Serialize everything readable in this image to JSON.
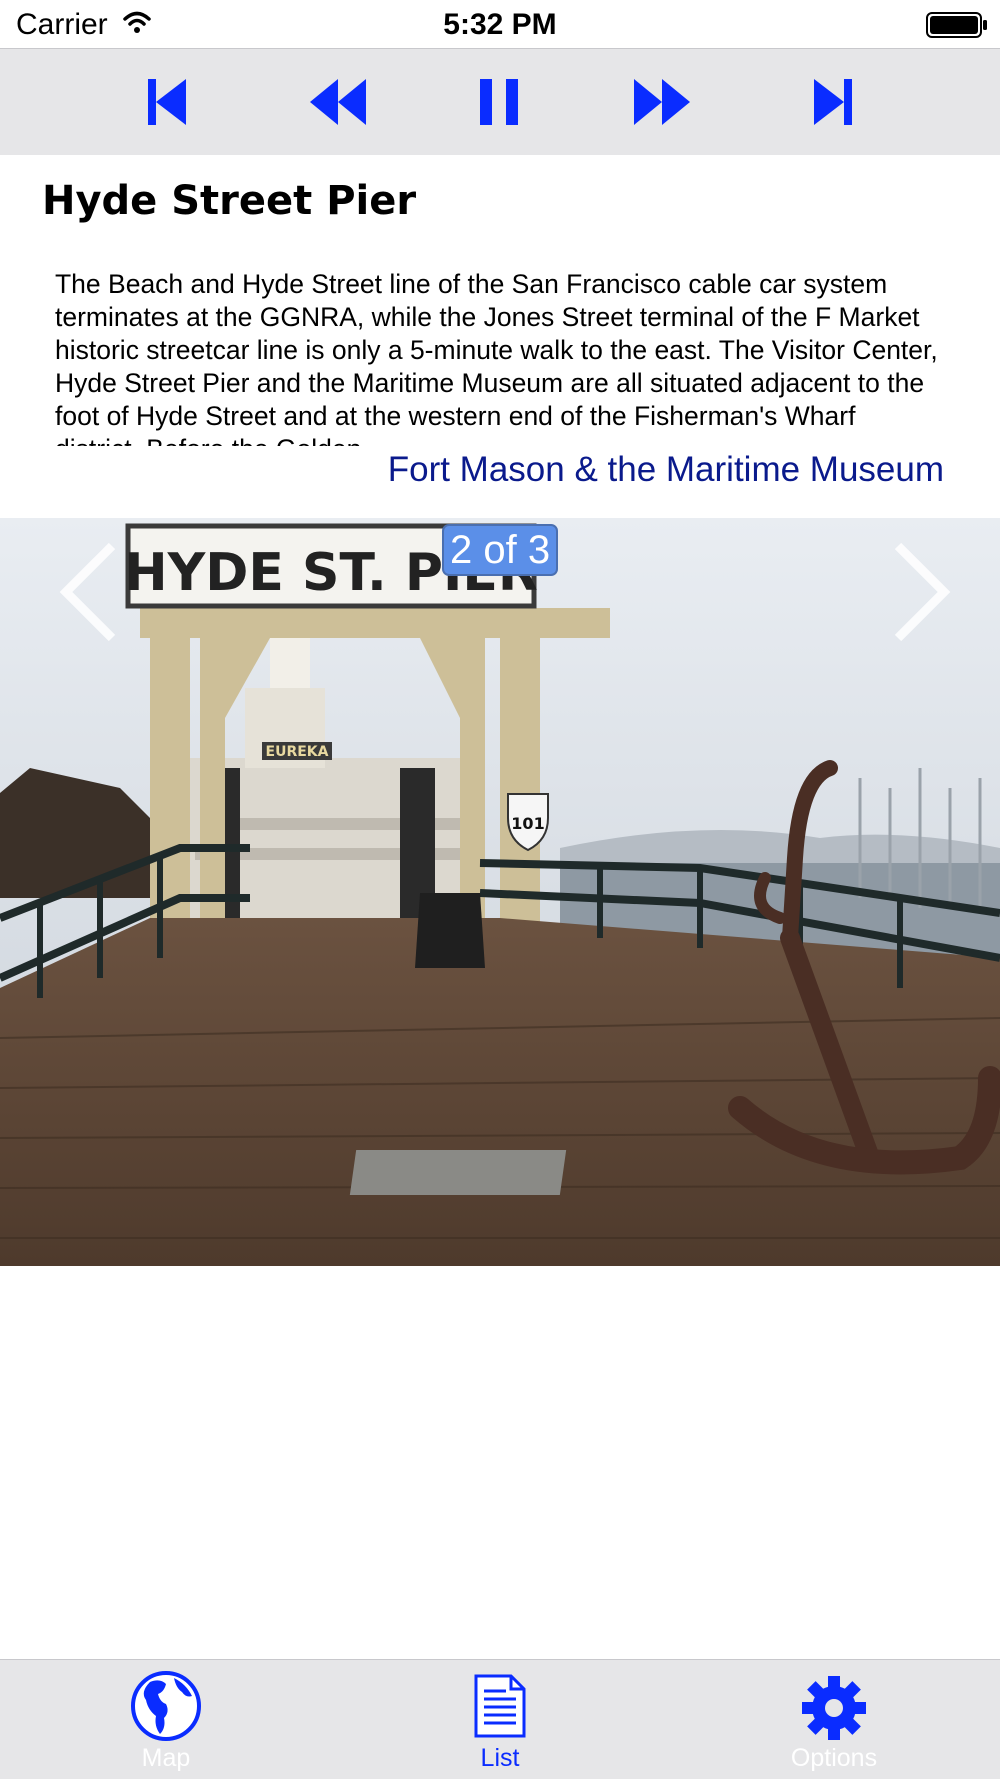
{
  "status_bar": {
    "carrier": "Carrier",
    "time": "5:32 PM",
    "icons": [
      "wifi-icon",
      "battery-icon"
    ]
  },
  "player": {
    "buttons": [
      "skip-to-start-icon",
      "rewind-icon",
      "pause-icon",
      "fast-forward-icon",
      "skip-to-end-icon"
    ],
    "accent_color": "#0a2cff"
  },
  "stop": {
    "title": "Hyde Street Pier",
    "description": "The Beach and Hyde Street line of the San Francisco cable car system terminates at the GGNRA, while the Jones Street terminal of the F Market historic streetcar line is only a 5-minute walk to the east. The Visitor Center, Hyde Street Pier and the Maritime Museum are all situated adjacent to the foot of Hyde Street and at the western end of the Fisherman's Wharf district. Before the Golden",
    "link": "Fort Mason & the Maritime Museum"
  },
  "photo": {
    "counter": "2 of 3",
    "sign_text": "HYDE ST. PIER",
    "ship_name": "EUREKA",
    "route_shield": "101",
    "nav_icons": [
      "chevron-left-icon",
      "chevron-right-icon"
    ]
  },
  "tabbar": {
    "tabs": [
      {
        "label": "Map",
        "icon": "globe-icon",
        "selected": false
      },
      {
        "label": "List",
        "icon": "document-icon",
        "selected": true
      },
      {
        "label": "Options",
        "icon": "gear-icon",
        "selected": false
      }
    ],
    "tab_color": "#0a2cff"
  }
}
